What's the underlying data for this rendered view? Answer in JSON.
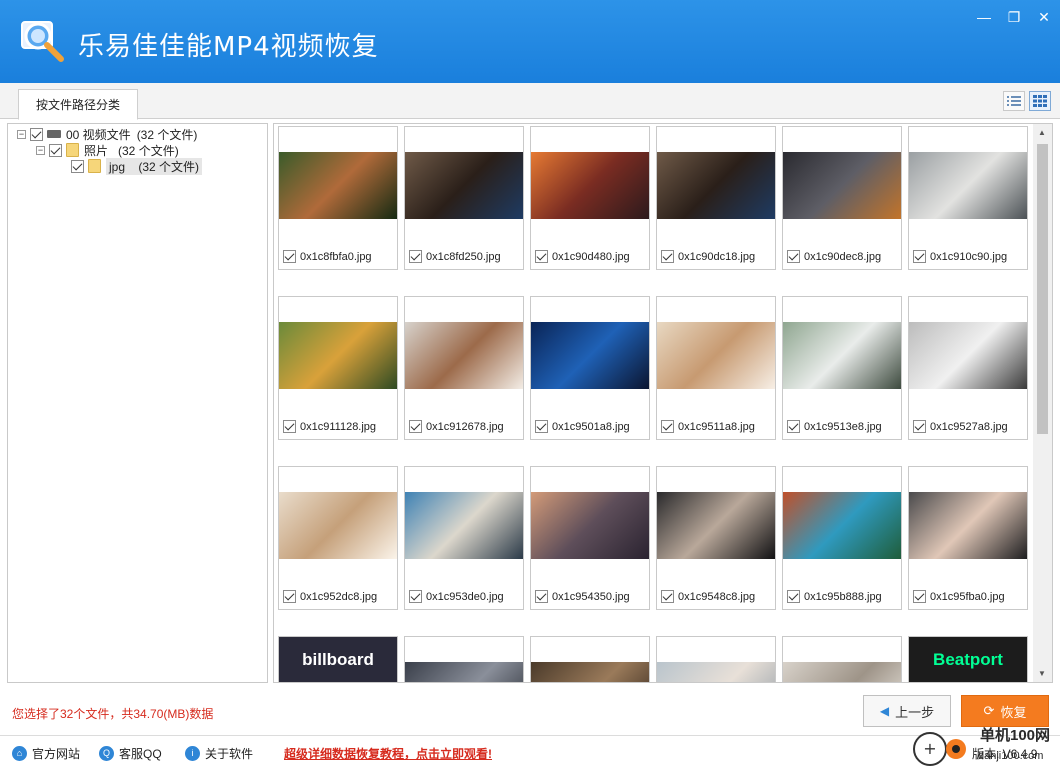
{
  "app": {
    "title": "乐易佳佳能MP4视频恢复"
  },
  "window_controls": [
    "min-icon",
    "restore-icon",
    "close-icon"
  ],
  "tabs": [
    {
      "label": "按文件路径分类"
    }
  ],
  "tree": {
    "root": {
      "label": "00 视频文件",
      "count": "(32 个文件)"
    },
    "child": {
      "label": "照片",
      "count": "(32 个文件)"
    },
    "leaf": {
      "label": "jpg",
      "count": "(32 个文件)"
    }
  },
  "files": [
    {
      "name": "0x1c8fbfa0.jpg",
      "colors": [
        "#3a5b2a",
        "#b06a3a",
        "#152a12"
      ]
    },
    {
      "name": "0x1c8fd250.jpg",
      "colors": [
        "#6f5a48",
        "#2a1f19",
        "#1e3b63"
      ]
    },
    {
      "name": "0x1c90d480.jpg",
      "colors": [
        "#e67a33",
        "#7a2c22",
        "#2c1a1c"
      ]
    },
    {
      "name": "0x1c90dc18.jpg",
      "colors": [
        "#6f5a48",
        "#2a1f19",
        "#1e3b63"
      ]
    },
    {
      "name": "0x1c90dec8.jpg",
      "colors": [
        "#2a2a30",
        "#5e5e66",
        "#c2742a"
      ]
    },
    {
      "name": "0x1c910c90.jpg",
      "colors": [
        "#9a9fa2",
        "#e2e2e0",
        "#4c5256"
      ]
    },
    {
      "name": "0x1c911128.jpg",
      "colors": [
        "#6a8a3a",
        "#d9a13a",
        "#2e4a23"
      ]
    },
    {
      "name": "0x1c912678.jpg",
      "colors": [
        "#d7d2cc",
        "#9c6a4a",
        "#f3ede6"
      ]
    },
    {
      "name": "0x1c9501a8.jpg",
      "colors": [
        "#0a2456",
        "#1f61b6",
        "#0b1530"
      ]
    },
    {
      "name": "0x1c9511a8.jpg",
      "colors": [
        "#e8d8c2",
        "#c79a71",
        "#f7efe6"
      ]
    },
    {
      "name": "0x1c9513e8.jpg",
      "colors": [
        "#8fa690",
        "#e9ecea",
        "#3d4a3e"
      ]
    },
    {
      "name": "0x1c9527a8.jpg",
      "colors": [
        "#bcbcbc",
        "#f0f0f0",
        "#3a3a3a"
      ]
    },
    {
      "name": "0x1c952dc8.jpg",
      "colors": [
        "#e9dccb",
        "#c5a07a",
        "#fbf4ea"
      ]
    },
    {
      "name": "0x1c953de0.jpg",
      "colors": [
        "#3f82b4",
        "#dcd7cc",
        "#2b3a48"
      ]
    },
    {
      "name": "0x1c954350.jpg",
      "colors": [
        "#d39b79",
        "#5e4e5a",
        "#2a2330"
      ]
    },
    {
      "name": "0x1c9548c8.jpg",
      "colors": [
        "#2a2a2c",
        "#b9a89a",
        "#111113"
      ]
    },
    {
      "name": "0x1c95b888.jpg",
      "colors": [
        "#c0502a",
        "#2f9abf",
        "#1f5d3a"
      ]
    },
    {
      "name": "0x1c95fba0.jpg",
      "colors": [
        "#4a4a4c",
        "#e0c7b7",
        "#1e1e20"
      ]
    },
    {
      "name": "",
      "colors": [
        "#2a2a3a",
        "#ffffff",
        "#2a2a3a"
      ],
      "text": "billboard"
    },
    {
      "name": "",
      "colors": [
        "#3a3f4a",
        "#8a8f9a",
        "#20242c"
      ]
    },
    {
      "name": "",
      "colors": [
        "#4a3a2a",
        "#9a7a5a",
        "#2a1f16"
      ]
    },
    {
      "name": "",
      "colors": [
        "#b9c4cc",
        "#e8e0d8",
        "#8a96a0"
      ]
    },
    {
      "name": "",
      "colors": [
        "#d8d2ca",
        "#9e9488",
        "#f2eee8"
      ]
    },
    {
      "name": "",
      "colors": [
        "#1c1c1c",
        "#01ff95",
        "#1c1c1c"
      ],
      "text": "Beatport"
    }
  ],
  "status_text": "您选择了32个文件，共34.70(MB)数据",
  "buttons": {
    "prev": "上一步",
    "recover": "恢复"
  },
  "footer": {
    "website": "官方网站",
    "qq": "客服QQ",
    "about": "关于软件",
    "promo": "超级详细数据恢复教程，点击立即观看!",
    "version": "版本: V6.4.9"
  },
  "watermark": {
    "brand": "单机100网",
    "url": "danji100.com"
  },
  "accent": {
    "titlebar": "#1a7fdc",
    "recover": "#f47b1f",
    "status": "#d62b1e"
  }
}
